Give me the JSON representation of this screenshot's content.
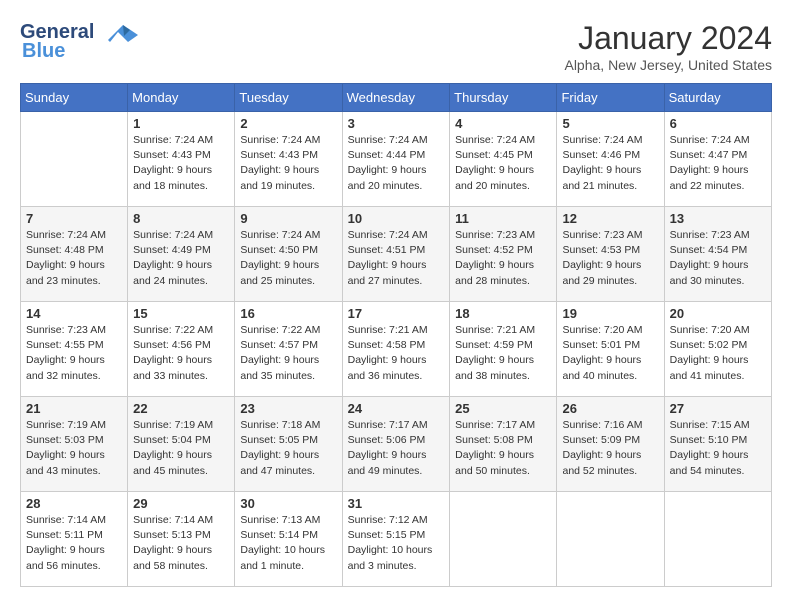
{
  "header": {
    "logo_line1": "General",
    "logo_line2": "Blue",
    "title": "January 2024",
    "subtitle": "Alpha, New Jersey, United States"
  },
  "calendar": {
    "days_of_week": [
      "Sunday",
      "Monday",
      "Tuesday",
      "Wednesday",
      "Thursday",
      "Friday",
      "Saturday"
    ],
    "weeks": [
      [
        {
          "day": "",
          "info": ""
        },
        {
          "day": "1",
          "info": "Sunrise: 7:24 AM\nSunset: 4:43 PM\nDaylight: 9 hours\nand 18 minutes."
        },
        {
          "day": "2",
          "info": "Sunrise: 7:24 AM\nSunset: 4:43 PM\nDaylight: 9 hours\nand 19 minutes."
        },
        {
          "day": "3",
          "info": "Sunrise: 7:24 AM\nSunset: 4:44 PM\nDaylight: 9 hours\nand 20 minutes."
        },
        {
          "day": "4",
          "info": "Sunrise: 7:24 AM\nSunset: 4:45 PM\nDaylight: 9 hours\nand 20 minutes."
        },
        {
          "day": "5",
          "info": "Sunrise: 7:24 AM\nSunset: 4:46 PM\nDaylight: 9 hours\nand 21 minutes."
        },
        {
          "day": "6",
          "info": "Sunrise: 7:24 AM\nSunset: 4:47 PM\nDaylight: 9 hours\nand 22 minutes."
        }
      ],
      [
        {
          "day": "7",
          "info": "Sunrise: 7:24 AM\nSunset: 4:48 PM\nDaylight: 9 hours\nand 23 minutes."
        },
        {
          "day": "8",
          "info": "Sunrise: 7:24 AM\nSunset: 4:49 PM\nDaylight: 9 hours\nand 24 minutes."
        },
        {
          "day": "9",
          "info": "Sunrise: 7:24 AM\nSunset: 4:50 PM\nDaylight: 9 hours\nand 25 minutes."
        },
        {
          "day": "10",
          "info": "Sunrise: 7:24 AM\nSunset: 4:51 PM\nDaylight: 9 hours\nand 27 minutes."
        },
        {
          "day": "11",
          "info": "Sunrise: 7:23 AM\nSunset: 4:52 PM\nDaylight: 9 hours\nand 28 minutes."
        },
        {
          "day": "12",
          "info": "Sunrise: 7:23 AM\nSunset: 4:53 PM\nDaylight: 9 hours\nand 29 minutes."
        },
        {
          "day": "13",
          "info": "Sunrise: 7:23 AM\nSunset: 4:54 PM\nDaylight: 9 hours\nand 30 minutes."
        }
      ],
      [
        {
          "day": "14",
          "info": "Sunrise: 7:23 AM\nSunset: 4:55 PM\nDaylight: 9 hours\nand 32 minutes."
        },
        {
          "day": "15",
          "info": "Sunrise: 7:22 AM\nSunset: 4:56 PM\nDaylight: 9 hours\nand 33 minutes."
        },
        {
          "day": "16",
          "info": "Sunrise: 7:22 AM\nSunset: 4:57 PM\nDaylight: 9 hours\nand 35 minutes."
        },
        {
          "day": "17",
          "info": "Sunrise: 7:21 AM\nSunset: 4:58 PM\nDaylight: 9 hours\nand 36 minutes."
        },
        {
          "day": "18",
          "info": "Sunrise: 7:21 AM\nSunset: 4:59 PM\nDaylight: 9 hours\nand 38 minutes."
        },
        {
          "day": "19",
          "info": "Sunrise: 7:20 AM\nSunset: 5:01 PM\nDaylight: 9 hours\nand 40 minutes."
        },
        {
          "day": "20",
          "info": "Sunrise: 7:20 AM\nSunset: 5:02 PM\nDaylight: 9 hours\nand 41 minutes."
        }
      ],
      [
        {
          "day": "21",
          "info": "Sunrise: 7:19 AM\nSunset: 5:03 PM\nDaylight: 9 hours\nand 43 minutes."
        },
        {
          "day": "22",
          "info": "Sunrise: 7:19 AM\nSunset: 5:04 PM\nDaylight: 9 hours\nand 45 minutes."
        },
        {
          "day": "23",
          "info": "Sunrise: 7:18 AM\nSunset: 5:05 PM\nDaylight: 9 hours\nand 47 minutes."
        },
        {
          "day": "24",
          "info": "Sunrise: 7:17 AM\nSunset: 5:06 PM\nDaylight: 9 hours\nand 49 minutes."
        },
        {
          "day": "25",
          "info": "Sunrise: 7:17 AM\nSunset: 5:08 PM\nDaylight: 9 hours\nand 50 minutes."
        },
        {
          "day": "26",
          "info": "Sunrise: 7:16 AM\nSunset: 5:09 PM\nDaylight: 9 hours\nand 52 minutes."
        },
        {
          "day": "27",
          "info": "Sunrise: 7:15 AM\nSunset: 5:10 PM\nDaylight: 9 hours\nand 54 minutes."
        }
      ],
      [
        {
          "day": "28",
          "info": "Sunrise: 7:14 AM\nSunset: 5:11 PM\nDaylight: 9 hours\nand 56 minutes."
        },
        {
          "day": "29",
          "info": "Sunrise: 7:14 AM\nSunset: 5:13 PM\nDaylight: 9 hours\nand 58 minutes."
        },
        {
          "day": "30",
          "info": "Sunrise: 7:13 AM\nSunset: 5:14 PM\nDaylight: 10 hours\nand 1 minute."
        },
        {
          "day": "31",
          "info": "Sunrise: 7:12 AM\nSunset: 5:15 PM\nDaylight: 10 hours\nand 3 minutes."
        },
        {
          "day": "",
          "info": ""
        },
        {
          "day": "",
          "info": ""
        },
        {
          "day": "",
          "info": ""
        }
      ]
    ]
  }
}
